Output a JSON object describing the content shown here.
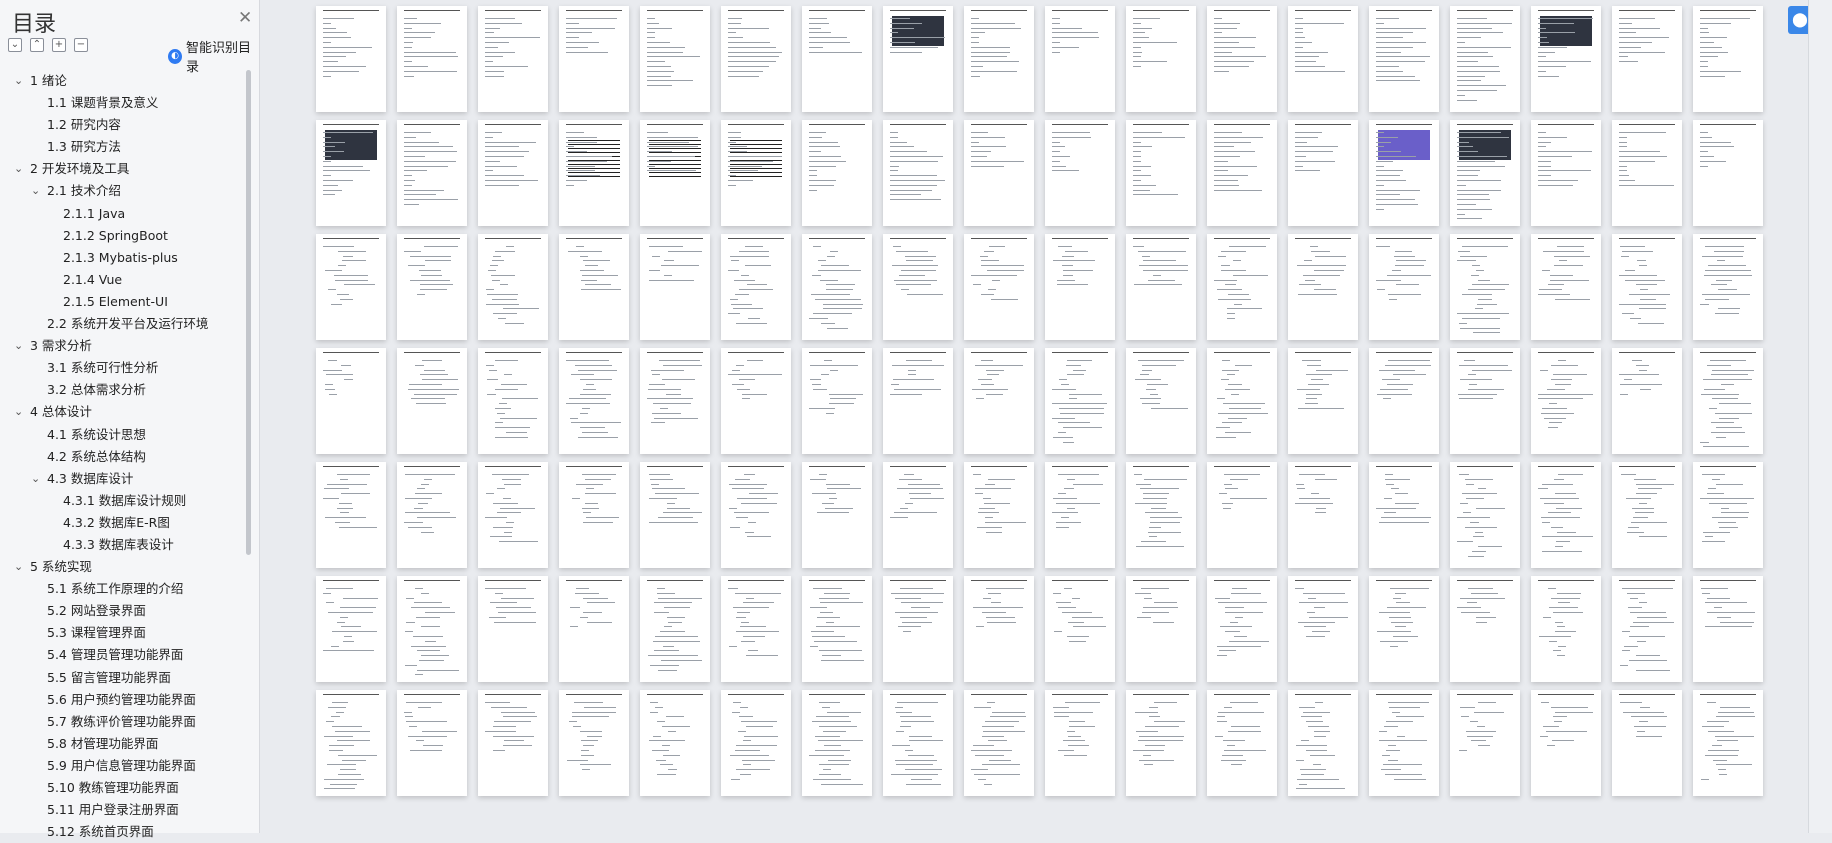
{
  "toc": {
    "title": "目录",
    "ai_button": "智能识别目录",
    "items": [
      {
        "num": "1",
        "label": "绪论",
        "level": 1,
        "expanded": true
      },
      {
        "num": "1.1",
        "label": "课题背景及意义",
        "level": 2
      },
      {
        "num": "1.2",
        "label": "研究内容",
        "level": 2
      },
      {
        "num": "1.3",
        "label": "研究方法",
        "level": 2
      },
      {
        "num": "2",
        "label": "开发环境及工具",
        "level": 1,
        "expanded": true
      },
      {
        "num": "2.1",
        "label": "技术介绍",
        "level": 2,
        "expanded": true
      },
      {
        "num": "2.1.1",
        "label": "Java",
        "level": 3
      },
      {
        "num": "2.1.2",
        "label": "SpringBoot",
        "level": 3
      },
      {
        "num": "2.1.3",
        "label": "Mybatis-plus",
        "level": 3
      },
      {
        "num": "2.1.4",
        "label": "Vue",
        "level": 3
      },
      {
        "num": "2.1.5",
        "label": "Element-UI",
        "level": 3
      },
      {
        "num": "2.2",
        "label": "系统开发平台及运行环境",
        "level": 2
      },
      {
        "num": "3",
        "label": "需求分析",
        "level": 1,
        "expanded": true
      },
      {
        "num": "3.1",
        "label": "系统可行性分析",
        "level": 2
      },
      {
        "num": "3.2",
        "label": "总体需求分析",
        "level": 2
      },
      {
        "num": "4",
        "label": "总体设计",
        "level": 1,
        "expanded": true
      },
      {
        "num": "4.1",
        "label": "系统设计思想",
        "level": 2
      },
      {
        "num": "4.2",
        "label": "系统总体结构",
        "level": 2
      },
      {
        "num": "4.3",
        "label": "数据库设计",
        "level": 2,
        "expanded": true
      },
      {
        "num": "4.3.1",
        "label": "数据库设计规则",
        "level": 3
      },
      {
        "num": "4.3.2",
        "label": "数据库E-R图",
        "level": 3
      },
      {
        "num": "4.3.3",
        "label": "数据库表设计",
        "level": 3
      },
      {
        "num": "5",
        "label": "系统实现",
        "level": 1,
        "expanded": true
      },
      {
        "num": "5.1",
        "label": "系统工作原理的介绍",
        "level": 2
      },
      {
        "num": "5.2",
        "label": "网站登录界面",
        "level": 2
      },
      {
        "num": "5.3",
        "label": "课程管理界面",
        "level": 2
      },
      {
        "num": "5.4",
        "label": "管理员管理功能界面",
        "level": 2
      },
      {
        "num": "5.5",
        "label": "留言管理功能界面",
        "level": 2
      },
      {
        "num": "5.6",
        "label": "用户预约管理功能界面",
        "level": 2
      },
      {
        "num": "5.7",
        "label": "教练评价管理功能界面",
        "level": 2
      },
      {
        "num": "5.8",
        "label": "材管理功能界面",
        "level": 2
      },
      {
        "num": "5.9",
        "label": "用户信息管理功能界面",
        "level": 2
      },
      {
        "num": "5.10",
        "label": "教练管理功能界面",
        "level": 2
      },
      {
        "num": "5.11",
        "label": "用户登录注册界面",
        "level": 2
      },
      {
        "num": "5.12",
        "label": "系统首页界面",
        "level": 2
      }
    ]
  },
  "toolbar_icons": [
    "expand-all-icon",
    "collapse-all-icon",
    "add-icon",
    "remove-icon"
  ],
  "pages_grid": {
    "rows": 7,
    "columns": 18
  },
  "colors": {
    "accent": "#2f7bf2",
    "sidebar_bg": "#f5f6f8",
    "doc_bg": "#e9ebef"
  }
}
